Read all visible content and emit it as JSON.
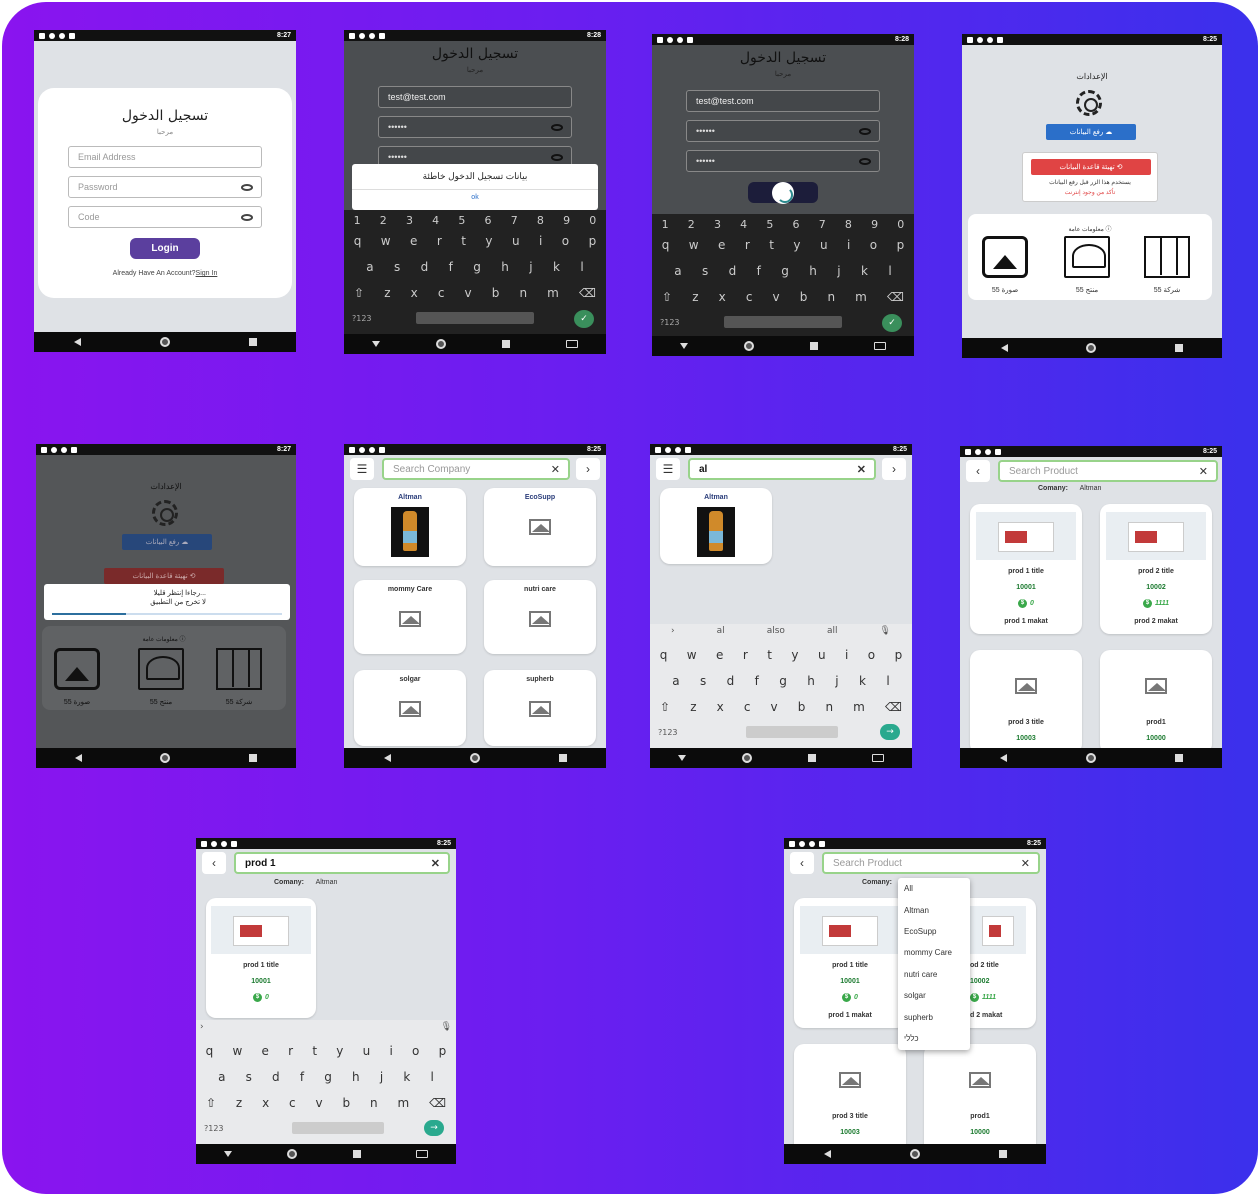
{
  "status": {
    "t1": "8:27",
    "t2": "8:28",
    "t3": "8:28",
    "t4": "8:25",
    "t5": "8:27",
    "t6": "8:25",
    "t7": "8:25",
    "t8": "8:25",
    "t9": "8:25",
    "t10": "8:25"
  },
  "login": {
    "title": "تسجيل الدخول",
    "welcome": "مرحبا",
    "email_placeholder": "Email Address",
    "password_placeholder": "Password",
    "code_placeholder": "Code",
    "login_label": "Login",
    "signup_prefix": "Already Have An Account?",
    "signup_link": "Sign In",
    "email_value": "test@test.com",
    "password_mask": "••••••",
    "code_mask": "••••••"
  },
  "error_dialog": {
    "message": "بيانات تسجيل الدخول خاطئة",
    "ok_label": "ok"
  },
  "keyboard": {
    "numbers": [
      "1",
      "2",
      "3",
      "4",
      "5",
      "6",
      "7",
      "8",
      "9",
      "0"
    ],
    "row1": [
      "q",
      "w",
      "e",
      "r",
      "t",
      "y",
      "u",
      "i",
      "o",
      "p"
    ],
    "row2": [
      "a",
      "s",
      "d",
      "f",
      "g",
      "h",
      "j",
      "k",
      "l"
    ],
    "row3": [
      "⇧",
      "z",
      "x",
      "c",
      "v",
      "b",
      "n",
      "m",
      "⌫"
    ],
    "sym_label": "?123",
    "comma": ",",
    "period": ".",
    "suggestions": [
      "al",
      "also",
      "all"
    ]
  },
  "settings": {
    "title": "الإعدادات",
    "upload_label": "رفع البيانات",
    "init_label": "تهيئة قاعدة البيانات",
    "warn1": "يستخدم هذا الزر قبل رفع البيانات",
    "warn2": "تأكد من وجود إنترنت",
    "info_title": "معلومات عامة",
    "stats": [
      {
        "label": "55 صورة"
      },
      {
        "label": "55 منتج"
      },
      {
        "label": "55 شركة"
      }
    ],
    "wait1": "رجاءا إنتظر قليلا...",
    "wait2": "لا تخرج من التطبيق"
  },
  "companies": {
    "search_placeholder": "Search Company",
    "search_value": "al",
    "items": [
      "Altman",
      "EcoSupp",
      "mommy Care",
      "nutri care",
      "solgar",
      "supherb"
    ]
  },
  "products": {
    "search_placeholder": "Search Product",
    "search_value": "prod 1",
    "company_label": "Comany:",
    "company_value": "Altman",
    "items": [
      {
        "title": "prod 1 title",
        "number": "10001",
        "price": "0",
        "makat": "prod 1 makat"
      },
      {
        "title": "prod 2 title",
        "number": "10002",
        "price": "1111",
        "makat": "prod 2 makat"
      },
      {
        "title": "prod 3 title",
        "number": "10003"
      },
      {
        "title": "prod1",
        "number": "10000"
      }
    ],
    "dropdown": [
      "All",
      "Altman",
      "EcoSupp",
      "mommy Care",
      "nutri care",
      "solgar",
      "supherb",
      "כללי"
    ],
    "partial_title2": "od 2 title",
    "partial_num2": "10002",
    "partial_price2": "1111",
    "partial_makat2": "d 2 makat"
  }
}
